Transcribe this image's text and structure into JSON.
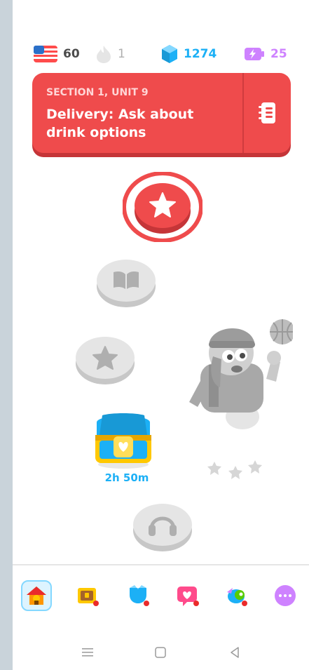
{
  "stats": {
    "course_flag": "us-flag-icon",
    "course_value": "60",
    "streak_value": "1",
    "gems_value": "1274",
    "energy_value": "25"
  },
  "unit": {
    "section_label": "SECTION 1, UNIT 9",
    "title": "Delivery: Ask about drink options"
  },
  "path": {
    "chest_timer": "2h 50m"
  },
  "nav": {
    "items": [
      "home-icon",
      "quests-chest-icon",
      "leaderboard-icon",
      "health-heart-icon",
      "shop-icon",
      "more-icon"
    ]
  },
  "colors": {
    "accent_red": "#ef4b4c",
    "accent_red_dark": "#c53538",
    "blue": "#1cb0f6",
    "gem_blue": "#1899d6",
    "energy_pink": "#ce82ff",
    "locked_gray": "#e5e5e5"
  }
}
